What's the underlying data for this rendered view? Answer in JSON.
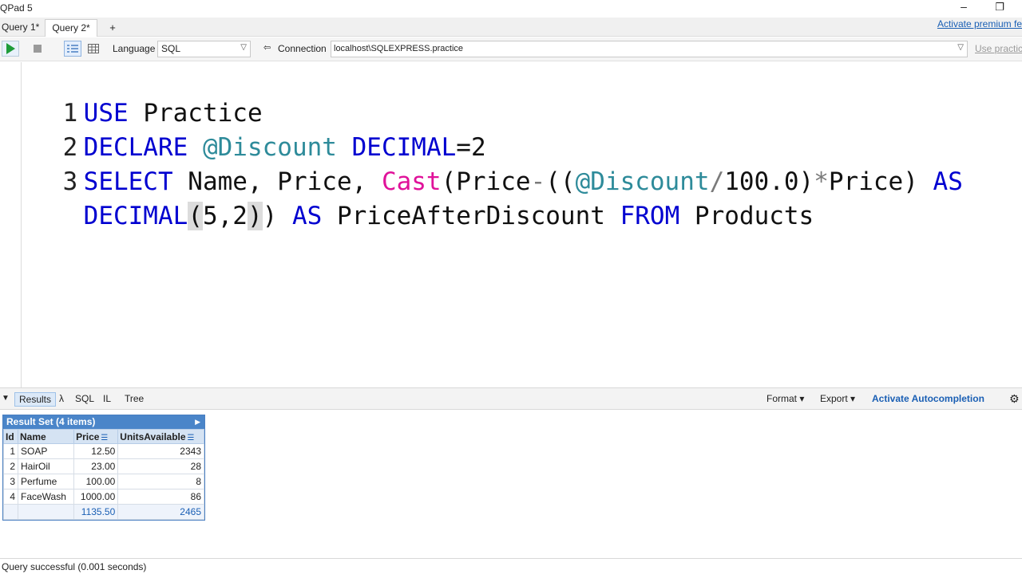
{
  "app": {
    "title": "QPad 5"
  },
  "tabs": [
    {
      "label": "Query 1*"
    },
    {
      "label": "Query 2*"
    },
    {
      "label": "+"
    }
  ],
  "premium_link": "Activate premium fe",
  "toolbar": {
    "language_label": "Language",
    "language_value": "SQL",
    "connection_label": "Connection",
    "connection_value": "localhost\\SQLEXPRESS.practice",
    "use_db_link": "Use practic"
  },
  "editor": {
    "line_numbers": [
      "1",
      "2",
      "3"
    ],
    "lines": [
      {
        "tokens": [
          "USE",
          " Practice"
        ]
      },
      {
        "tokens": [
          "DECLARE",
          " ",
          "@Discount",
          " ",
          "DECIMAL",
          "=2"
        ]
      },
      {
        "tokens": [
          "SELECT",
          " Name, Price, ",
          "Cast",
          "(Price",
          "-",
          "((",
          "@Discount",
          "/",
          "100.0)",
          "*",
          "Price) ",
          "AS"
        ]
      },
      {
        "tokens": [
          "DECIMAL",
          "(",
          "5,2",
          ")",
          ") ",
          "AS",
          " PriceAfterDiscount ",
          "FROM",
          " Products"
        ]
      }
    ]
  },
  "results_bar": {
    "results_tab": "Results",
    "lambda_tab": "λ",
    "sql_tab": "SQL",
    "il_tab": "IL",
    "tree_tab": "Tree",
    "format_label": "Format",
    "export_label": "Export",
    "autocompletion_label": "Activate Autocompletion"
  },
  "result_set": {
    "title": "Result Set (4 items)",
    "columns": [
      "Id",
      "Name",
      "Price",
      "UnitsAvailable"
    ],
    "rows": [
      [
        "1",
        "SOAP",
        "12.50",
        "2343"
      ],
      [
        "2",
        "HairOil",
        "23.00",
        "28"
      ],
      [
        "3",
        "Perfume",
        "100.00",
        "8"
      ],
      [
        "4",
        "FaceWash",
        "1000.00",
        "86"
      ]
    ],
    "totals": {
      "price": "1135.50",
      "units": "2465"
    }
  },
  "status": {
    "text": "Query successful  (0.001 seconds)"
  },
  "colors": {
    "keyword": "#0000d0",
    "variable": "#2e8b9a",
    "function": "#e0129a",
    "accent": "#1a5fb4",
    "grid_header": "#4a85c9"
  }
}
